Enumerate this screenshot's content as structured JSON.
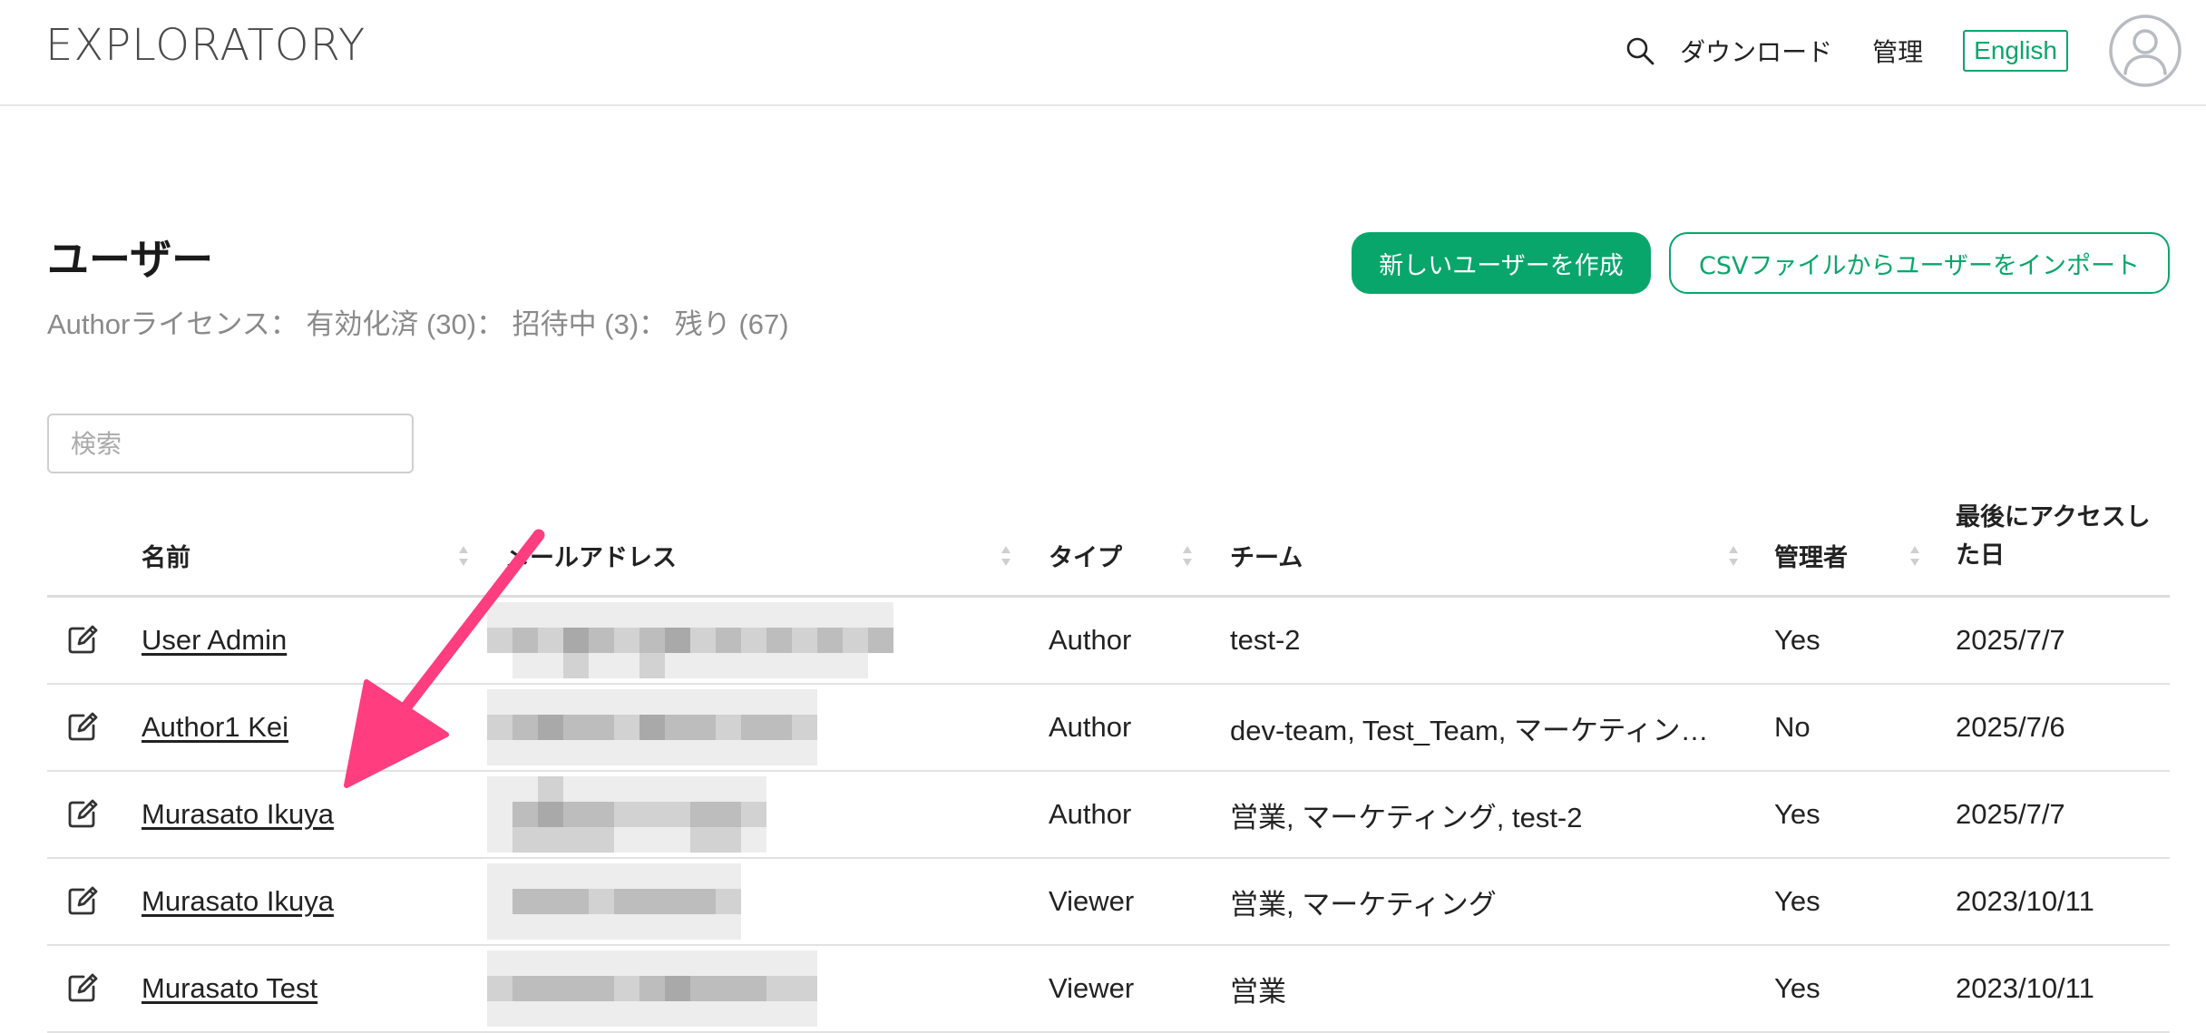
{
  "app": {
    "logo": "EXPLORATORY"
  },
  "nav": {
    "search_icon": "search-icon",
    "download": "ダウンロード",
    "admin": "管理",
    "language": "English",
    "avatar_icon": "user-avatar-icon"
  },
  "page": {
    "title": "ユーザー",
    "license_info": "Authorライセンス： 有効化済 (30)： 招待中 (3)： 残り (67)",
    "create_button": "新しいユーザーを作成",
    "import_button": "CSVファイルからユーザーをインポート",
    "search_placeholder": "検索",
    "search_value": ""
  },
  "colors": {
    "accent": "#08a66b",
    "annotation": "#ff3d7f"
  },
  "table": {
    "columns": {
      "name": "名前",
      "email": "メールアドレス",
      "type": "タイプ",
      "team": "チーム",
      "admin": "管理者",
      "last_access": "最後にアクセスした日"
    },
    "rows": [
      {
        "name": "User Admin",
        "type": "Author",
        "team": "test-2",
        "admin": "Yes",
        "last_access": "2025/7/7"
      },
      {
        "name": "Author1 Kei",
        "type": "Author",
        "team": "dev-team, Test_Team, マーケティン…",
        "admin": "No",
        "last_access": "2025/7/6"
      },
      {
        "name": "Murasato Ikuya",
        "type": "Author",
        "team": "営業, マーケティング, test-2",
        "admin": "Yes",
        "last_access": "2025/7/7"
      },
      {
        "name": "Murasato Ikuya",
        "type": "Viewer",
        "team": "営業, マーケティング",
        "admin": "Yes",
        "last_access": "2023/10/11"
      },
      {
        "name": "Murasato Test",
        "type": "Viewer",
        "team": "営業",
        "admin": "Yes",
        "last_access": "2023/10/11"
      }
    ]
  }
}
